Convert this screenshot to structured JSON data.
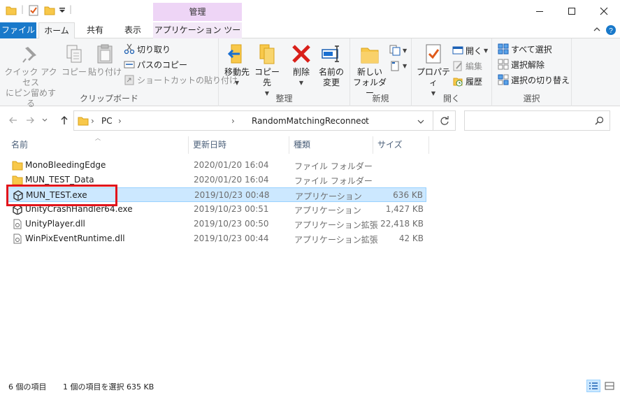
{
  "title_bar": {
    "context_header": "管理",
    "buttons": [
      "minimize",
      "maximize",
      "close"
    ]
  },
  "tabs": {
    "file": "ファイル",
    "home": "ホーム",
    "share": "共有",
    "view": "表示",
    "app_tools": "アプリケーション ツール"
  },
  "ribbon": {
    "clipboard": {
      "label": "クリップボード",
      "pin_line1": "クイック アクセス",
      "pin_line2": "にピン留めする",
      "copy": "コピー",
      "paste": "貼り付け",
      "cut": "切り取り",
      "copy_path": "パスのコピー",
      "paste_shortcut": "ショートカットの貼り付け"
    },
    "organize": {
      "label": "整理",
      "move_to": "移動先",
      "copy_to": "コピー先",
      "delete": "削除",
      "rename_line1": "名前の",
      "rename_line2": "変更"
    },
    "new": {
      "label": "新規",
      "new_folder_line1": "新しい",
      "new_folder_line2": "フォルダー"
    },
    "open": {
      "label": "開く",
      "properties": "プロパティ",
      "open": "開く",
      "edit": "編集",
      "history": "履歴"
    },
    "select": {
      "label": "選択",
      "select_all": "すべて選択",
      "select_none": "選択解除",
      "invert": "選択の切り替え"
    }
  },
  "address": {
    "crumbs": [
      "PC",
      "RandomMatchingReconnect"
    ]
  },
  "columns": {
    "name": "名前",
    "date": "更新日時",
    "type": "種類",
    "size": "サイズ"
  },
  "files": [
    {
      "name": "MonoBleedingEdge",
      "date": "2020/01/20 16:04",
      "type": "ファイル フォルダー",
      "size": "",
      "icon": "folder-icon"
    },
    {
      "name": "MUN_TEST_Data",
      "date": "2020/01/20 16:04",
      "type": "ファイル フォルダー",
      "size": "",
      "icon": "folder-icon"
    },
    {
      "name": "MUN_TEST.exe",
      "date": "2019/10/23 00:48",
      "type": "アプリケーション",
      "size": "636 KB",
      "icon": "unity-icon",
      "selected": true
    },
    {
      "name": "UnityCrashHandler64.exe",
      "date": "2019/10/23 00:51",
      "type": "アプリケーション",
      "size": "1,427 KB",
      "icon": "unity-icon"
    },
    {
      "name": "UnityPlayer.dll",
      "date": "2019/10/23 00:50",
      "type": "アプリケーション拡張",
      "size": "22,418 KB",
      "icon": "dll-icon"
    },
    {
      "name": "WinPixEventRuntime.dll",
      "date": "2019/10/23 00:44",
      "type": "アプリケーション拡張",
      "size": "42 KB",
      "icon": "dll-icon"
    }
  ],
  "status": {
    "count": "6 個の項目",
    "selection": "1 個の項目を選択  635 KB"
  },
  "colors": {
    "file_tab": "#1979ca",
    "context_tab": "#eed5f6",
    "selection": "#cce8ff",
    "highlight": "#e2141b"
  }
}
